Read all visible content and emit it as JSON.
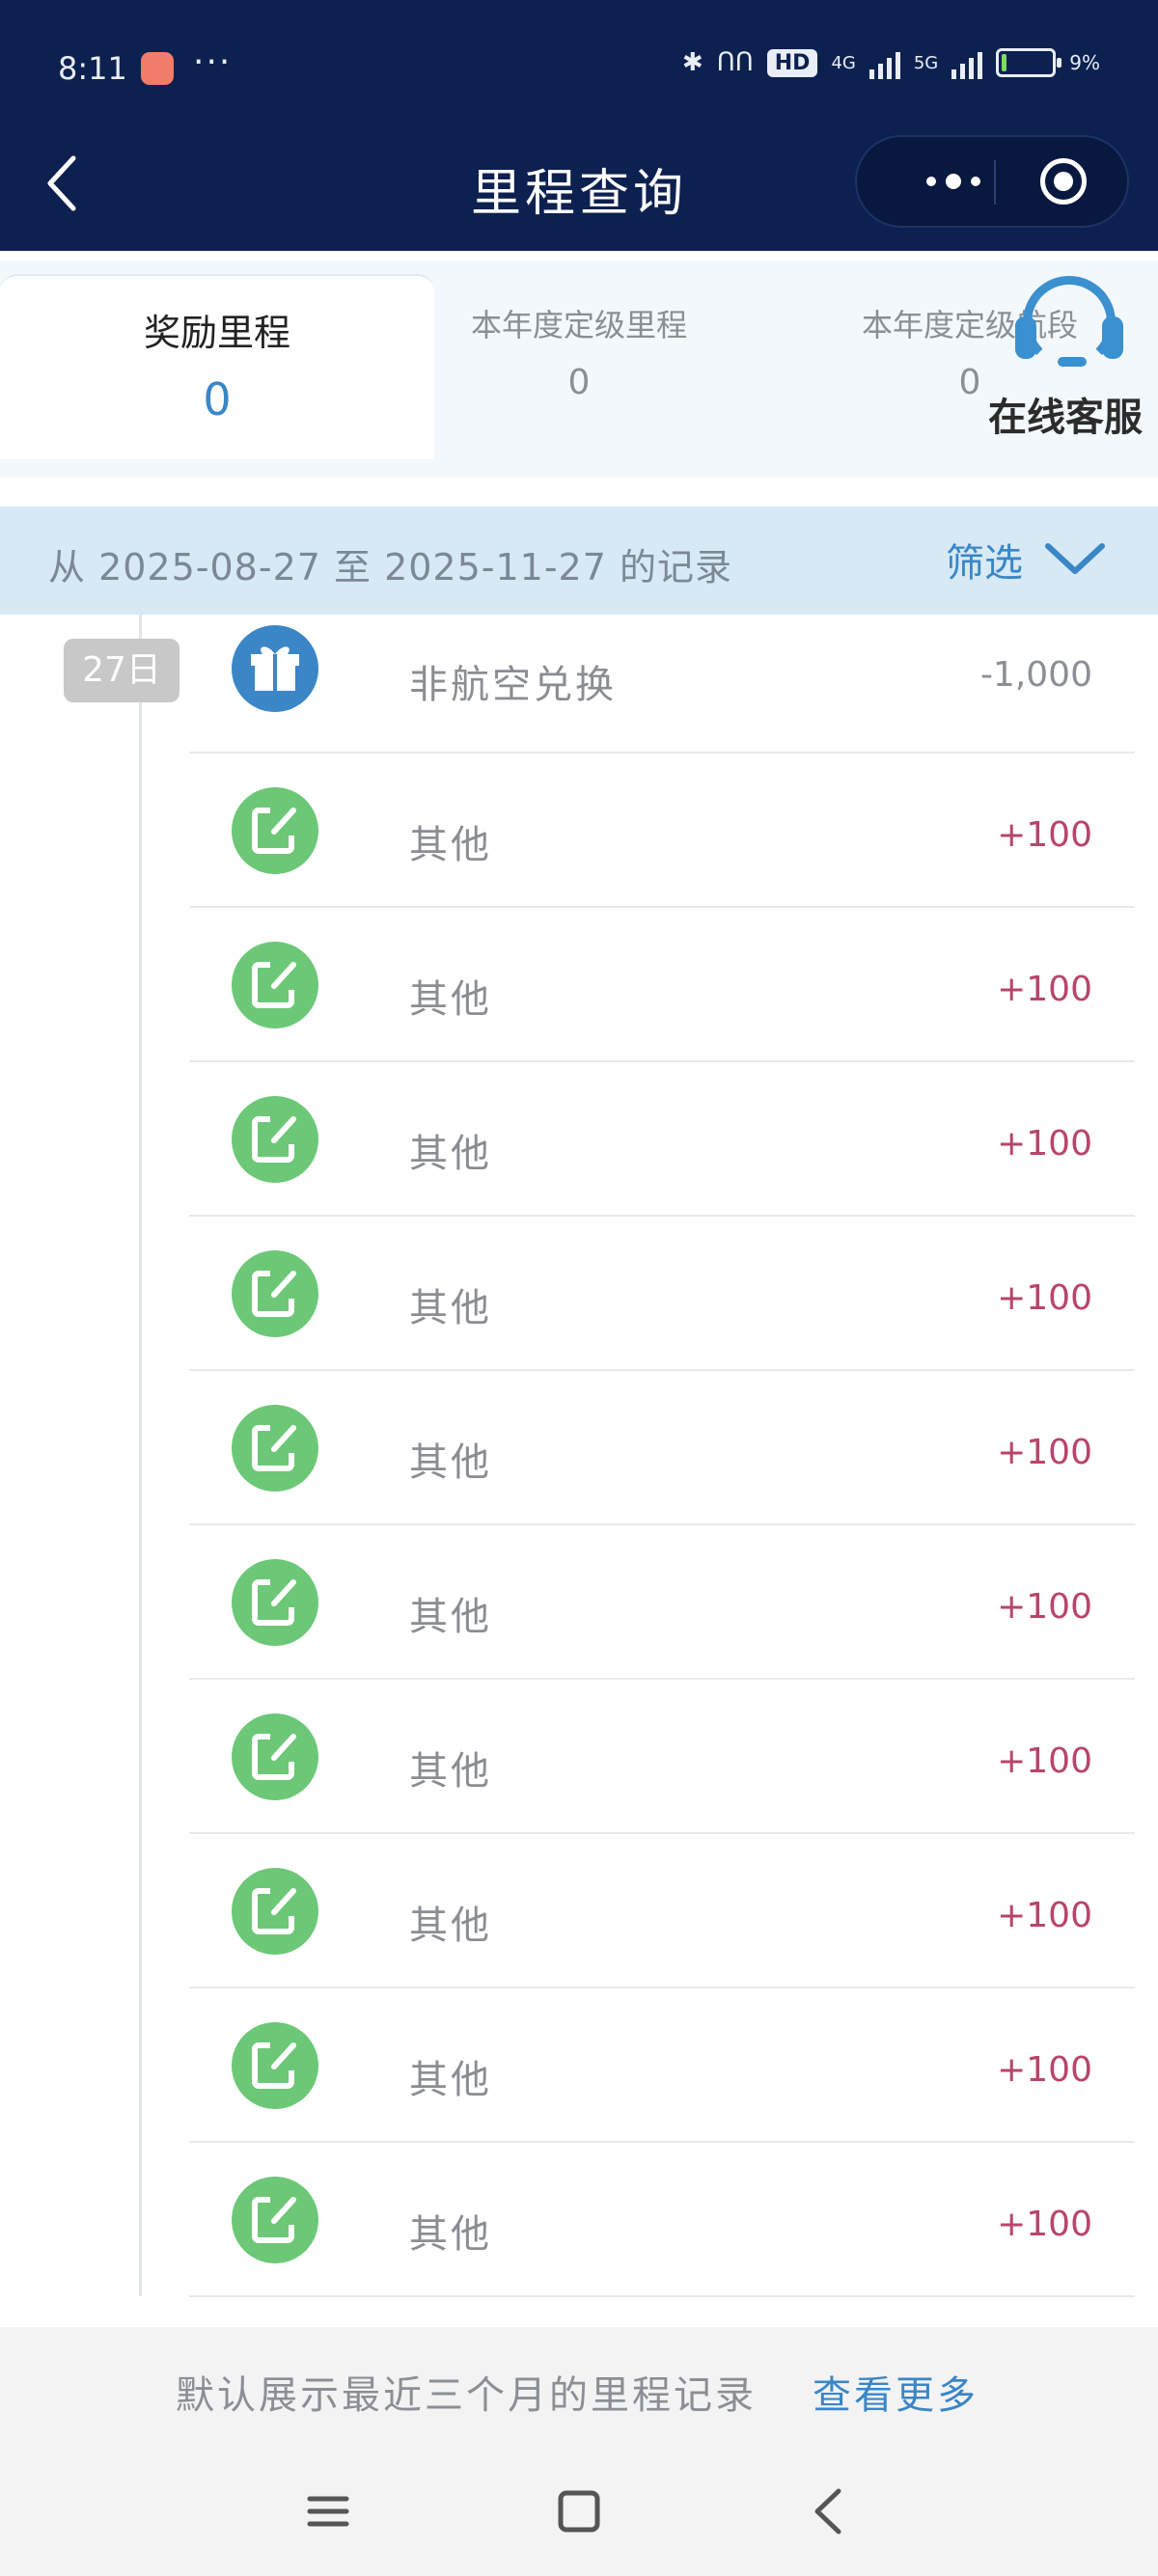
{
  "status_bar": {
    "time": "8:11",
    "more": "···",
    "network_4g": "4G",
    "network_5g": "5G",
    "hd": "HD",
    "battery_level": "9%",
    "battery_fraction": 0.09
  },
  "header": {
    "title": "里程查询",
    "back_icon": "chevron-left-icon",
    "menu_icon": "more-dots-icon",
    "close_icon": "target-icon"
  },
  "tabs": [
    {
      "label": "奖励里程",
      "value": "0"
    },
    {
      "label": "本年度定级里程",
      "value": "0"
    },
    {
      "label": "本年度定级航段",
      "value": "0"
    }
  ],
  "customer_service": {
    "label": "在线客服",
    "icon": "headset-icon"
  },
  "record_range": {
    "text": "从 2025-08-27 至 2025-11-27 的记录",
    "filter_label": "筛选",
    "filter_icon": "chevron-down-icon"
  },
  "records": {
    "date_badge": "27日",
    "items": [
      {
        "label": "非航空兑换",
        "amount": "-1,000",
        "type": "gift",
        "icon": "gift-icon"
      },
      {
        "label": "其他",
        "amount": "+100",
        "type": "other",
        "icon": "edit-icon"
      },
      {
        "label": "其他",
        "amount": "+100",
        "type": "other",
        "icon": "edit-icon"
      },
      {
        "label": "其他",
        "amount": "+100",
        "type": "other",
        "icon": "edit-icon"
      },
      {
        "label": "其他",
        "amount": "+100",
        "type": "other",
        "icon": "edit-icon"
      },
      {
        "label": "其他",
        "amount": "+100",
        "type": "other",
        "icon": "edit-icon"
      },
      {
        "label": "其他",
        "amount": "+100",
        "type": "other",
        "icon": "edit-icon"
      },
      {
        "label": "其他",
        "amount": "+100",
        "type": "other",
        "icon": "edit-icon"
      },
      {
        "label": "其他",
        "amount": "+100",
        "type": "other",
        "icon": "edit-icon"
      },
      {
        "label": "其他",
        "amount": "+100",
        "type": "other",
        "icon": "edit-icon"
      },
      {
        "label": "其他",
        "amount": "+100",
        "type": "other",
        "icon": "edit-icon"
      }
    ]
  },
  "footer": {
    "note": "默认展示最近三个月的里程记录",
    "link": "查看更多"
  },
  "colors": {
    "header_bg": "#0d2150",
    "accent_blue": "#3a86c6",
    "gift_icon_bg": "#3a86c6",
    "other_icon_bg": "#6cc877",
    "positive_amount": "#b8446c",
    "negative_amount": "#8b8f95"
  }
}
